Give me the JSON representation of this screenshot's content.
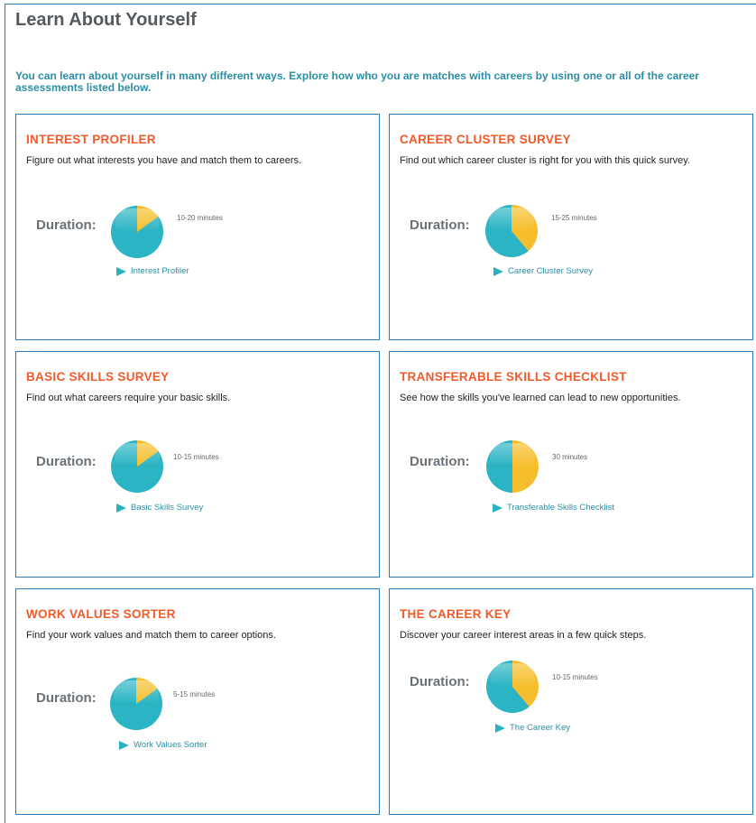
{
  "page": {
    "title": "Learn About Yourself",
    "intro": "You can learn about yourself in many different ways. Explore how who you are matches with careers by using one or all of the career assessments listed below."
  },
  "colors": {
    "accent_teal": "#2ab4c4",
    "pie_yellow": "#f6be2c",
    "title_orange": "#f25a2a",
    "border_blue": "#2b7bb9",
    "link_teal": "#2a8fa5"
  },
  "labels": {
    "duration": "Duration:"
  },
  "cards": [
    {
      "title": "INTEREST PROFILER",
      "description": "Figure out what interests you have and match them to careers.",
      "duration": "10-20 minutes",
      "duration_fraction": 0.15,
      "link": "Interest Profiler"
    },
    {
      "title": "CAREER CLUSTER SURVEY",
      "description": "Find out which career cluster is right for you with this quick survey.",
      "duration": "15-25 minutes",
      "duration_fraction": 0.39,
      "link": "Career Cluster Survey"
    },
    {
      "title": "BASIC SKILLS SURVEY",
      "description": "Find out what careers require your basic skills.",
      "duration": "10-15 minutes",
      "duration_fraction": 0.15,
      "link": "Basic Skills Survey"
    },
    {
      "title": "TRANSFERABLE SKILLS CHECKLIST",
      "description": "See how the skills you've learned can lead to new opportunities.",
      "duration": "30 minutes",
      "duration_fraction": 0.5,
      "link": "Transferable Skills Checklist"
    },
    {
      "title": "WORK VALUES SORTER",
      "description": "Find your work values and match them to career options.",
      "duration": "5-15 minutes",
      "duration_fraction": 0.15,
      "link": "Work Values Sorter"
    },
    {
      "title": "THE CAREER KEY",
      "description": "Discover your career interest areas in a few quick steps.",
      "duration": "10-15 minutes",
      "duration_fraction": 0.39,
      "link": "The Career Key"
    }
  ]
}
